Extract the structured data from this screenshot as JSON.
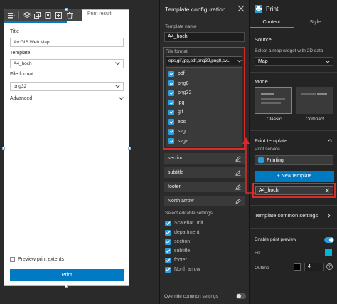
{
  "preview": {
    "tab_print_result": "Print result",
    "title_label": "Title",
    "title_value": "ArcGIS Web Map",
    "template_label": "Template",
    "template_value": "A4_hoch",
    "file_format_label": "File format",
    "file_format_value": "png32",
    "advanced_label": "Advanced",
    "preview_extents_label": "Preview print extents",
    "print_button": "Print"
  },
  "template_config": {
    "title": "Template configuration",
    "template_name_label": "Template name",
    "template_name_value": "A4_hoch",
    "file_format_label": "File format",
    "file_format_selected": "eps,gif,jpg,pdf,png32,png8,sv...",
    "formats": [
      "pdf",
      "png8",
      "png32",
      "jpg",
      "gif",
      "eps",
      "svg",
      "svgz"
    ],
    "fields": [
      "section",
      "subtitle",
      "footer",
      "North arrow"
    ],
    "editable_label": "Select editable settings",
    "editable": [
      "Scalebar unit",
      "department",
      "section",
      "subtitle",
      "footer",
      "North arrow"
    ],
    "override_label": "Override common settings"
  },
  "settings": {
    "title": "Print",
    "tab_content": "Content",
    "tab_style": "Style",
    "source_label": "Source",
    "map_widget_label": "Select a map widget with 2D data",
    "map_value": "Map",
    "mode_label": "Mode",
    "mode_classic": "Classic",
    "mode_compact": "Compact",
    "print_template_label": "Print template",
    "print_service_label": "Print service",
    "service_value": "Printing",
    "new_template_button": "+ New template",
    "template_item": "A4_hoch",
    "common_settings_label": "Template common settings",
    "enable_preview_label": "Enable print preview",
    "fill_label": "Fill",
    "outline_label": "Outline",
    "outline_width": "4",
    "colors": {
      "accent": "#007ac2",
      "fill_swatch": "#00b4d8",
      "highlight": "#d82c2c"
    }
  }
}
